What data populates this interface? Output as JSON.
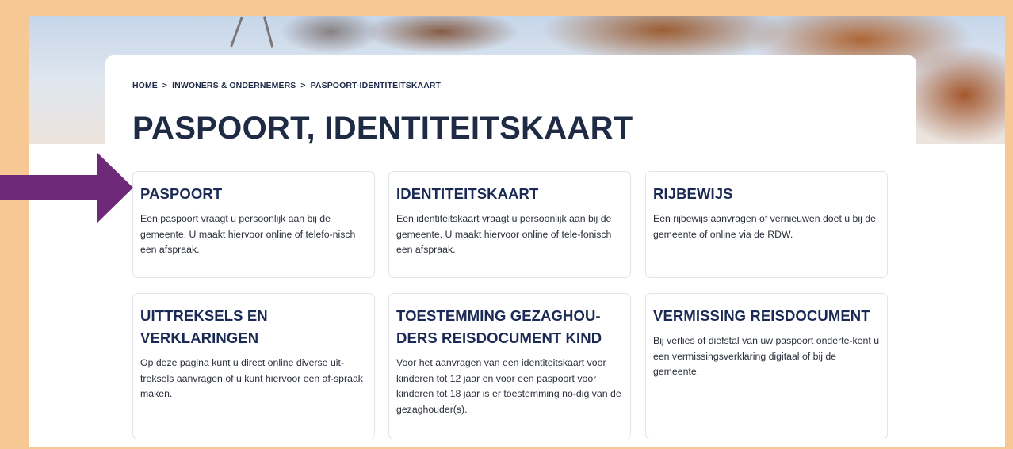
{
  "breadcrumb": {
    "home": "HOME",
    "sep1": ">",
    "section": "INWONERS & ONDERNEMERS",
    "sep2": ">",
    "current": "PASPOORT-IDENTITEITSKAART"
  },
  "page_title": "PASPOORT, IDENTITEITSKAART",
  "tiles": [
    {
      "title": "PASPOORT",
      "text": "Een paspoort vraagt u persoonlijk aan bij de gemeente. U maakt hiervoor online of telefo-nisch een afspraak."
    },
    {
      "title": "IDENTITEITSKAART",
      "text": "Een identiteitskaart vraagt u persoonlijk aan bij de gemeente. U maakt hiervoor online of tele-fonisch een afspraak."
    },
    {
      "title": "RIJBEWIJS",
      "text": "Een rijbewijs aanvragen of vernieuwen doet u bij de gemeente of online via de RDW."
    },
    {
      "title": "UITTREKSELS EN VERKLARINGEN",
      "text": "Op deze pagina kunt u direct online diverse uit-treksels aanvragen of u kunt hiervoor een af-spraak maken."
    },
    {
      "title": "TOESTEMMING GEZAGHOU-DERS REISDOCUMENT KIND",
      "text": "Voor het aanvragen van een identiteitskaart voor kinderen tot 12 jaar en voor een paspoort voor kinderen tot 18 jaar is er toestemming no-dig van de gezaghouder(s)."
    },
    {
      "title": "VERMISSING REISDOCUMENT",
      "text": "Bij verlies of diefstal van uw paspoort onderte-kent u een vermissingsverklaring digitaal of bij de gemeente."
    }
  ],
  "colors": {
    "frame": "#f5c894",
    "title": "#1f2b45",
    "tile_title": "#1a2a55",
    "arrow": "#6e2a78"
  },
  "icons": {
    "annotation_arrow": "right-arrow-icon"
  }
}
